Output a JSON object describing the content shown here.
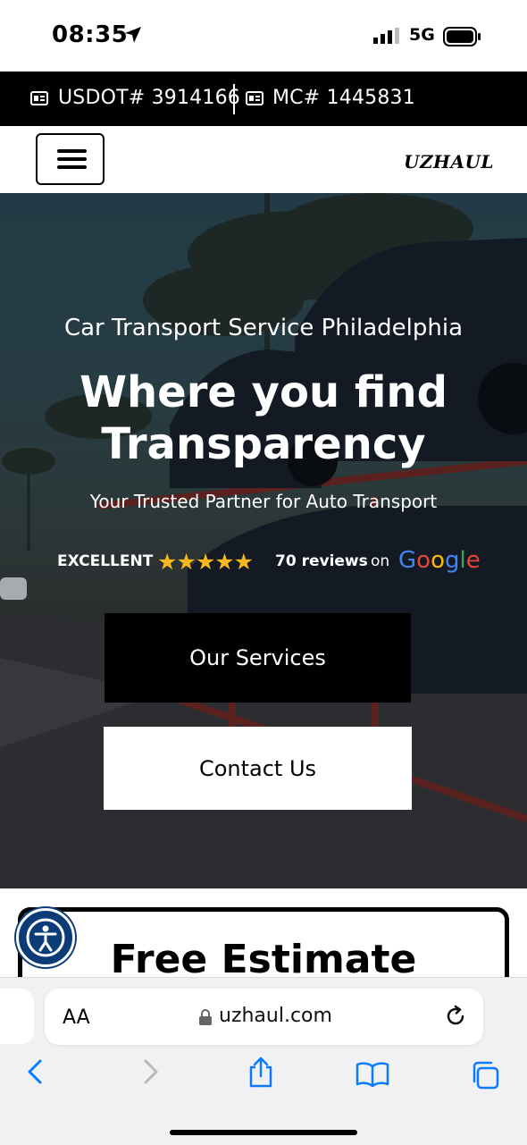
{
  "status_bar": {
    "time": "08:35",
    "network": "5G"
  },
  "license_bar": {
    "usdot": "USDOT# 3914166",
    "mc": "MC# 1445831"
  },
  "header": {
    "logo": "UZHAUL"
  },
  "hero": {
    "tagline": "Car Transport Service Philadelphia",
    "title": "Where you find Transparency",
    "subtitle": "Your Trusted Partner for Auto Transport",
    "rating": {
      "label": "EXCELLENT",
      "stars": "★★★★★",
      "star_count": 5,
      "reviews": "70 reviews",
      "on": "on",
      "source": "Google"
    },
    "services_button": "Our Services",
    "contact_button": "Contact Us"
  },
  "estimate": {
    "title": "Free Estimate"
  },
  "browser": {
    "text_size_label": "AA",
    "url": "uzhaul.com"
  },
  "colors": {
    "star": "#f8b81c",
    "accessibility_blue": "#0b3c77",
    "ios_blue": "#0a7aff"
  }
}
